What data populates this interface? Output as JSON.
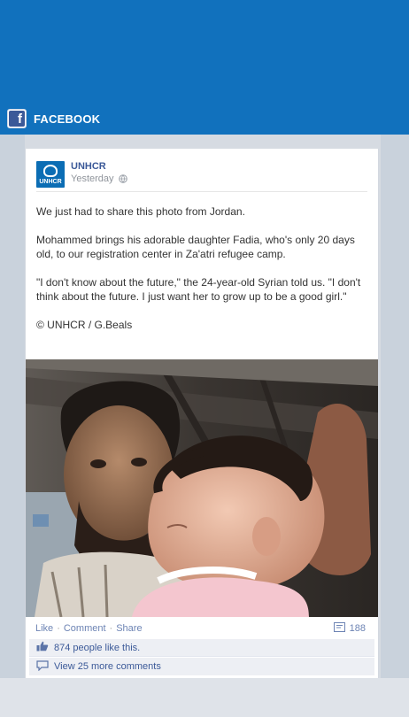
{
  "header": {
    "title": "FACEBOOK",
    "logo_letter": "f"
  },
  "post": {
    "page_name": "UNHCR",
    "avatar_text": "UNHCR",
    "time": "Yesterday",
    "paragraphs": [
      "We just had to share this photo from Jordan.",
      "Mohammed brings his adorable daughter Fadia, who's only 20 days old, to our registration center in Za'atri refugee camp.",
      "\"I don't know about the future,\" the 24-year-old Syrian told us. \"I don't think about the future. I just want her to grow up to be a good girl.\"",
      "© UNHCR / G.Beals"
    ],
    "actions": {
      "like": "Like",
      "comment": "Comment",
      "share": "Share",
      "separator": "·"
    },
    "share_count": "188",
    "likes_text": "874 people like this.",
    "comments_text": "View 25 more comments"
  },
  "colors": {
    "brand_blue": "#1171bd",
    "facebook_blue": "#3b5998",
    "link_blue": "#6d84b4"
  }
}
